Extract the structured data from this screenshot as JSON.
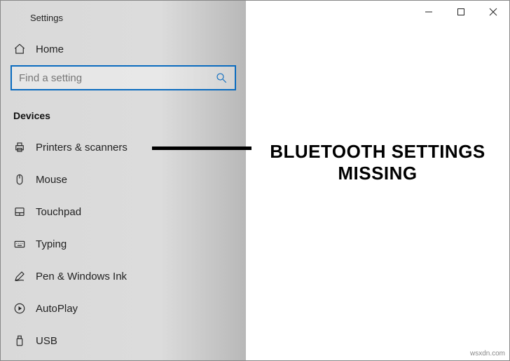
{
  "window": {
    "title": "Settings"
  },
  "sidebar": {
    "home_label": "Home",
    "search_placeholder": "Find a setting",
    "section_header": "Devices",
    "items": [
      {
        "id": "printers",
        "label": "Printers & scanners"
      },
      {
        "id": "mouse",
        "label": "Mouse"
      },
      {
        "id": "touchpad",
        "label": "Touchpad"
      },
      {
        "id": "typing",
        "label": "Typing"
      },
      {
        "id": "pen",
        "label": "Pen & Windows Ink"
      },
      {
        "id": "autoplay",
        "label": "AutoPlay"
      },
      {
        "id": "usb",
        "label": "USB"
      }
    ]
  },
  "annotation": {
    "line1": "BLUETOOTH SETTINGS",
    "line2": "MISSING"
  },
  "watermark": "wsxdn.com"
}
